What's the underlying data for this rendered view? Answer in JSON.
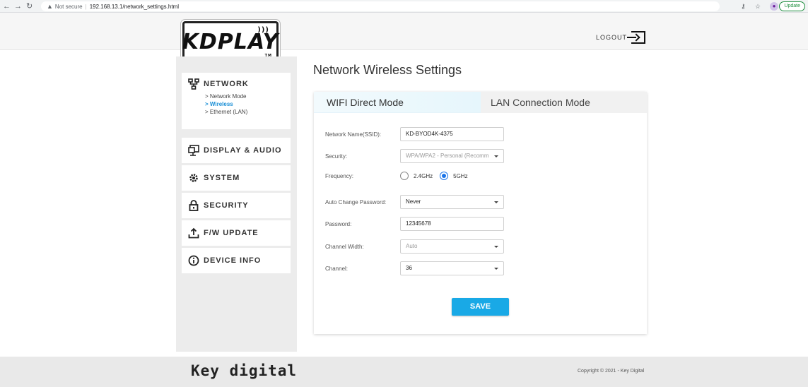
{
  "browser": {
    "security_text": "Not secure",
    "url": "192.168.13.1/network_settings.html",
    "update_label": "Update"
  },
  "header": {
    "logo_text": "KDPLAY",
    "logo_tm": "TM",
    "logout_label": "LOGOUT"
  },
  "sidebar": {
    "network": {
      "label": "NETWORK",
      "subitems": [
        "> Network Mode",
        "> Wireless",
        "> Ethernet (LAN)"
      ]
    },
    "items": [
      {
        "label": "DISPLAY & AUDIO",
        "icon": "monitor-icon"
      },
      {
        "label": "SYSTEM",
        "icon": "gear-icon"
      },
      {
        "label": "SECURITY",
        "icon": "lock-icon"
      },
      {
        "label": "F/W UPDATE",
        "icon": "upload-icon"
      },
      {
        "label": "DEVICE INFO",
        "icon": "info-icon"
      }
    ]
  },
  "main": {
    "title": "Network Wireless Settings",
    "tabs": [
      {
        "label": "WIFI Direct Mode",
        "active": true
      },
      {
        "label": "LAN Connection Mode",
        "active": false
      }
    ],
    "form": {
      "ssid_label": "Network Name(SSID):",
      "ssid_value": "KD-BYOD4K-4375",
      "security_label": "Security:",
      "security_value": "WPA/WPA2 - Personal (Recomm",
      "frequency_label": "Frequency:",
      "freq_options": [
        "2.4GHz",
        "5GHz"
      ],
      "freq_selected": "5GHz",
      "auto_change_label": "Auto Change Password:",
      "auto_change_value": "Never",
      "password_label": "Password:",
      "password_value": "12345678",
      "channel_width_label": "Channel Width:",
      "channel_width_value": "Auto",
      "channel_label": "Channel:",
      "channel_value": "36"
    },
    "save_label": "SAVE"
  },
  "footer": {
    "brand": "Key digital",
    "copyright": "Copyright © 2021 - Key Digital"
  },
  "colors": {
    "accent": "#19a9e6",
    "active_link": "#1a8fd6",
    "sidebar_bg": "#ececec"
  }
}
